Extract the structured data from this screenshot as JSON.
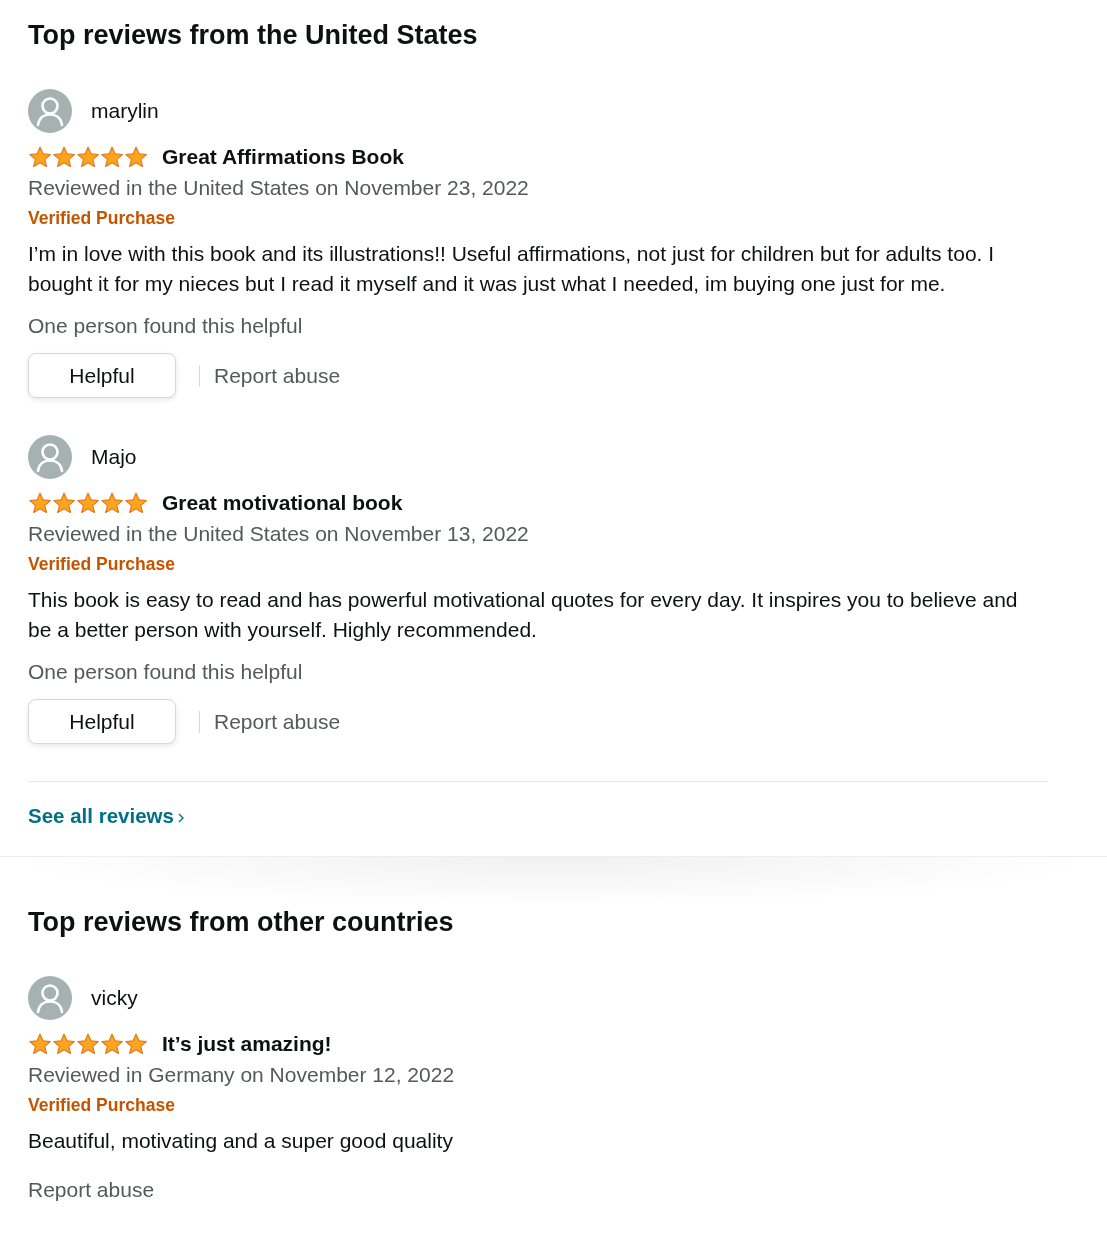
{
  "sections": [
    {
      "title": "Top reviews from the United States",
      "reviews": [
        {
          "author": "marylin",
          "stars": 5,
          "title": "Great Affirmations Book",
          "meta": "Reviewed in the United States on November 23, 2022",
          "badge": "Verified Purchase",
          "body": "I’m in love with this book and its illustrations!! Useful affirmations, not just for children but for adults too. I bought it for my nieces but I read it myself and it was just what I needed, im buying one just for me.",
          "helpful_count": "One person found this helpful",
          "helpful_button": "Helpful",
          "report": "Report abuse"
        },
        {
          "author": "Majo",
          "stars": 5,
          "title": "Great motivational book",
          "meta": "Reviewed in the United States on November 13, 2022",
          "badge": "Verified Purchase",
          "body": "This book is easy to read and has powerful motivational quotes for every day. It inspires you to believe and be a better person with yourself. Highly recommended.",
          "helpful_count": "One person found this helpful",
          "helpful_button": "Helpful",
          "report": "Report abuse"
        }
      ],
      "footer_link": "See all reviews"
    },
    {
      "title": "Top reviews from other countries",
      "reviews": [
        {
          "author": "vicky",
          "stars": 5,
          "title": "It’s just amazing!",
          "meta": "Reviewed in Germany on November 12, 2022",
          "badge": "Verified Purchase",
          "body": "Beautiful, motivating and a super good quality",
          "report": "Report abuse"
        }
      ]
    }
  ]
}
